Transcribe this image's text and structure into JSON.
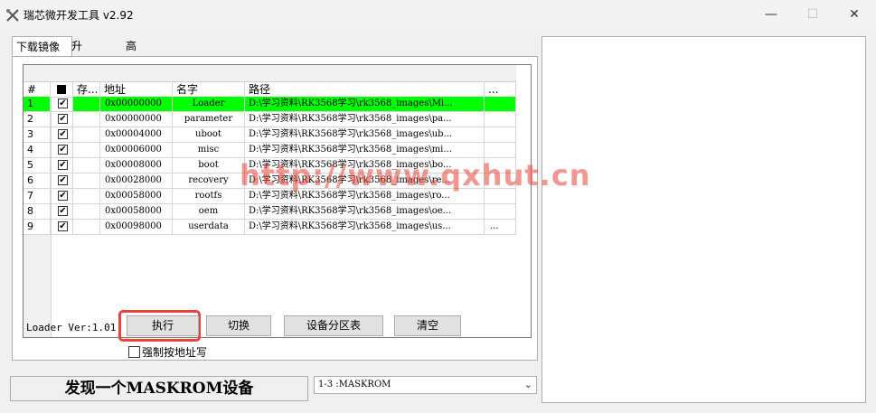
{
  "window": {
    "title": "瑞芯微开发工具 v2.92",
    "min_label": "—",
    "max_label": "☐",
    "close_label": "✕"
  },
  "tabs": [
    {
      "label": "下载镜像"
    },
    {
      "label": "升级固件"
    },
    {
      "label": "高级功能"
    }
  ],
  "table": {
    "headers": {
      "num": "#",
      "store": "存...",
      "address": "地址",
      "name": "名字",
      "path": "路径",
      "more": "..."
    },
    "rows": [
      {
        "num": "1",
        "check": "✔",
        "address": "0x00000000",
        "name": "Loader",
        "path": "D:\\学习资料\\RK3568学习\\rk3568_images\\Mi...",
        "more": "",
        "highlight": true
      },
      {
        "num": "2",
        "check": "✔",
        "address": "0x00000000",
        "name": "parameter",
        "path": "D:\\学习资料\\RK3568学习\\rk3568_images\\pa...",
        "more": ""
      },
      {
        "num": "3",
        "check": "✔",
        "address": "0x00004000",
        "name": "uboot",
        "path": "D:\\学习资料\\RK3568学习\\rk3568_images\\ub...",
        "more": ""
      },
      {
        "num": "4",
        "check": "✔",
        "address": "0x00006000",
        "name": "misc",
        "path": "D:\\学习资料\\RK3568学习\\rk3568_images\\mi...",
        "more": ""
      },
      {
        "num": "5",
        "check": "✔",
        "address": "0x00008000",
        "name": "boot",
        "path": "D:\\学习资料\\RK3568学习\\rk3568_images\\bo...",
        "more": ""
      },
      {
        "num": "6",
        "check": "✔",
        "address": "0x00028000",
        "name": "recovery",
        "path": "D:\\学习资料\\RK3568学习\\rk3568_images\\re...",
        "more": ""
      },
      {
        "num": "7",
        "check": "✔",
        "address": "0x00058000",
        "name": "rootfs",
        "path": "D:\\学习资料\\RK3568学习\\rk3568_images\\ro...",
        "more": ""
      },
      {
        "num": "8",
        "check": "✔",
        "address": "0x00058000",
        "name": "oem",
        "path": "D:\\学习资料\\RK3568学习\\rk3568_images\\oe...",
        "more": ""
      },
      {
        "num": "9",
        "check": "✔",
        "address": "0x00098000",
        "name": "userdata",
        "path": "D:\\学习资料\\RK3568学习\\rk3568_images\\us...",
        "more": "..."
      }
    ]
  },
  "loader_version": "Loader Ver:1.01",
  "buttons": {
    "execute": "执行",
    "switch": "切换",
    "partition_table": "设备分区表",
    "clear": "清空"
  },
  "force_address": {
    "label": "强制按地址写",
    "checked": false
  },
  "status": {
    "text": "发现一个MASKROM设备"
  },
  "device_select": {
    "value": "1-3 :MASKROM"
  },
  "watermark": "http://www.qxhut.cn",
  "colors": {
    "highlight_row": "#00ff00",
    "annotation_ring": "#e8443a"
  }
}
